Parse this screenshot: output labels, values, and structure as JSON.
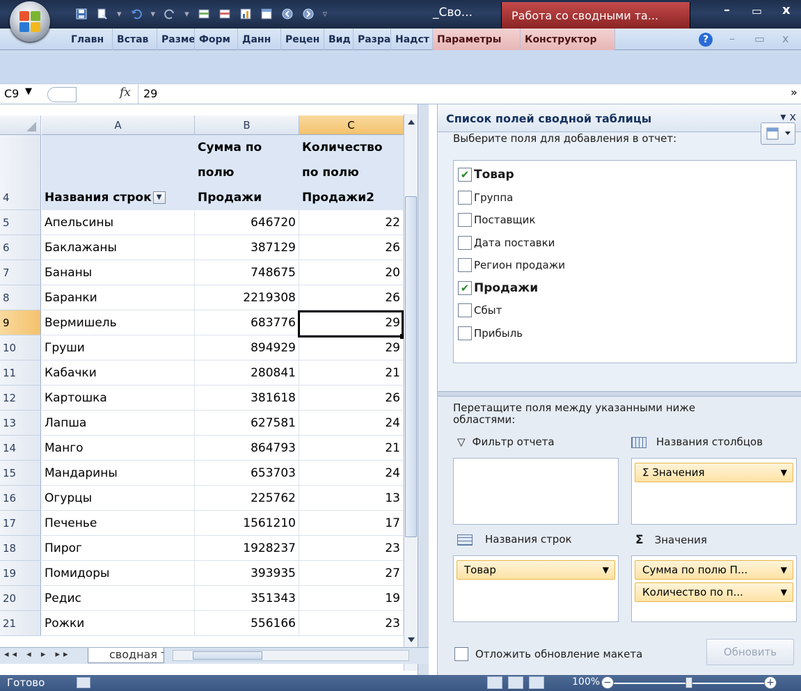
{
  "window": {
    "doc_title": "_Сво...",
    "context_title": "Работа со сводными та...",
    "min": "–",
    "max": "▭",
    "close": "x"
  },
  "ribbon": {
    "tabs": [
      "Главн",
      "Встав",
      "Разме",
      "Форм",
      "Данн",
      "Рецен",
      "Вид",
      "Разра",
      "Надст"
    ],
    "context_tabs": [
      "Параметры",
      "Конструктор"
    ],
    "help": "?"
  },
  "formula_bar": {
    "name_box": "C9",
    "fx": "fx",
    "value": "29"
  },
  "grid": {
    "columns": [
      "A",
      "B",
      "C"
    ],
    "selected_column": "C",
    "header_row_number": "4",
    "header": {
      "col_a": "Названия строк",
      "col_b_line1": "Сумма по",
      "col_b_line2": "полю",
      "col_b_line3": "Продажи",
      "col_c_line1": "Количество",
      "col_c_line2": "по полю",
      "col_c_line3": "Продажи2"
    },
    "rows": [
      {
        "n": "5",
        "a": "Апельсины",
        "b": "646720",
        "c": "22"
      },
      {
        "n": "6",
        "a": "Баклажаны",
        "b": "387129",
        "c": "26"
      },
      {
        "n": "7",
        "a": "Бананы",
        "b": "748675",
        "c": "20"
      },
      {
        "n": "8",
        "a": "Баранки",
        "b": "2219308",
        "c": "26"
      },
      {
        "n": "9",
        "a": "Вермишель",
        "b": "683776",
        "c": "29"
      },
      {
        "n": "10",
        "a": "Груши",
        "b": "894929",
        "c": "29"
      },
      {
        "n": "11",
        "a": "Кабачки",
        "b": "280841",
        "c": "21"
      },
      {
        "n": "12",
        "a": "Картошка",
        "b": "381618",
        "c": "26"
      },
      {
        "n": "13",
        "a": "Лапша",
        "b": "627581",
        "c": "24"
      },
      {
        "n": "14",
        "a": "Манго",
        "b": "864793",
        "c": "21"
      },
      {
        "n": "15",
        "a": "Мандарины",
        "b": "653703",
        "c": "24"
      },
      {
        "n": "16",
        "a": "Огурцы",
        "b": "225762",
        "c": "13"
      },
      {
        "n": "17",
        "a": "Печенье",
        "b": "1561210",
        "c": "17"
      },
      {
        "n": "18",
        "a": "Пирог",
        "b": "1928237",
        "c": "23"
      },
      {
        "n": "19",
        "a": "Помидоры",
        "b": "393935",
        "c": "27"
      },
      {
        "n": "20",
        "a": "Редис",
        "b": "351343",
        "c": "19"
      },
      {
        "n": "21",
        "a": "Рожки",
        "b": "556166",
        "c": "23"
      }
    ],
    "selected_row": "9"
  },
  "sheet": {
    "nav": "◂◂ ◂ ▸ ▸▸",
    "tab_name": "сводная таблица"
  },
  "status": {
    "ready": "Готово",
    "zoom": "100%"
  },
  "pivot": {
    "title": "Список полей сводной таблицы",
    "choose_label": "Выберите поля для добавления в отчет:",
    "fields": [
      {
        "label": "Товар",
        "checked": true
      },
      {
        "label": "Группа",
        "checked": false
      },
      {
        "label": "Поставщик",
        "checked": false
      },
      {
        "label": "Дата поставки",
        "checked": false
      },
      {
        "label": "Регион продажи",
        "checked": false
      },
      {
        "label": "Продажи",
        "checked": true
      },
      {
        "label": "Сбыт",
        "checked": false
      },
      {
        "label": "Прибыль",
        "checked": false
      }
    ],
    "drag_label": "Перетащите поля между указанными ниже областями:",
    "zones": {
      "filter_label": "Фильтр отчета",
      "columns_label": "Названия столбцов",
      "rows_label": "Названия строк",
      "values_label": "Значения",
      "columns_item": "Σ  Значения",
      "rows_item": "Товар",
      "values_item_1": "Сумма по полю П...",
      "values_item_2": "Количество по п..."
    },
    "defer_label": "Отложить обновление макета",
    "update_button": "Обновить"
  },
  "colors": {
    "title_bar": "#1e2f4d",
    "context_tab": "#b83a3a",
    "selection_header": "#f4c26d",
    "pivot_header_bg": "#dce6f4",
    "pill_bg": "#fde2a4"
  }
}
